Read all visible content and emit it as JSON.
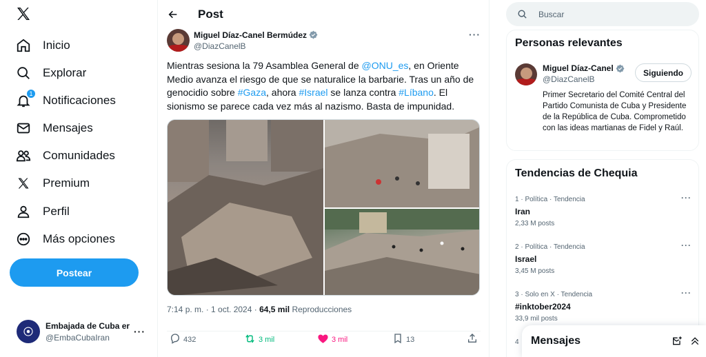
{
  "nav": {
    "items": [
      {
        "label": "Inicio",
        "icon": "home-icon"
      },
      {
        "label": "Explorar",
        "icon": "search-icon"
      },
      {
        "label": "Notificaciones",
        "icon": "bell-icon",
        "badge": "1"
      },
      {
        "label": "Mensajes",
        "icon": "mail-icon"
      },
      {
        "label": "Comunidades",
        "icon": "people-icon"
      },
      {
        "label": "Premium",
        "icon": "x-logo-icon"
      },
      {
        "label": "Perfil",
        "icon": "person-icon"
      },
      {
        "label": "Más opciones",
        "icon": "more-circle-icon"
      }
    ],
    "post_button": "Postear",
    "account": {
      "name": "Embajada de Cuba er",
      "handle": "@EmbaCubaIran"
    }
  },
  "header": {
    "title": "Post"
  },
  "tweet": {
    "author_name": "Miguel Díaz-Canel Bermúdez",
    "author_handle": "@DiazCanelB",
    "text_parts": [
      "Mientras sesiona la 79 Asamblea General de ",
      "@ONU_es",
      ", en Oriente Medio avanza el riesgo de que se naturalice la barbarie. Tras un año de genocidio sobre ",
      "#Gaza",
      ", ahora ",
      "#Israel",
      " se lanza contra ",
      "#Líbano",
      ". El sionismo se parece cada vez más al nazismo. Basta de impunidad."
    ],
    "timestamp": "7:14 p. m. · 1 oct. 2024 · ",
    "views": "64,5 mil",
    "views_label": " Reproducciones",
    "replies": "432",
    "reposts": "3 mil",
    "likes": "3 mil",
    "bookmarks": "13",
    "colors": {
      "repost": "#00ba7c",
      "like": "#f91880",
      "link": "#1d9bf0"
    }
  },
  "search": {
    "placeholder": "Buscar"
  },
  "relevant": {
    "title": "Personas relevantes",
    "name": "Miguel Díaz-Canel",
    "handle": "@DiazCanelB",
    "follow_label": "Siguiendo",
    "bio": "Primer Secretario del Comité Central del Partido Comunista de Cuba y Presidente de la República de Cuba. Comprometido con las ideas martianas de Fidel y Raúl."
  },
  "trends": {
    "title": "Tendencias de Chequia",
    "items": [
      {
        "meta": "1 · Política · Tendencia",
        "name": "Iran",
        "count": "2,33 M posts"
      },
      {
        "meta": "2 · Política · Tendencia",
        "name": "Israel",
        "count": "3,45 M posts"
      },
      {
        "meta": "3 · Solo en X · Tendencia",
        "name": "#inktober2024",
        "count": "33,9 mil posts"
      },
      {
        "meta": "4"
      }
    ]
  },
  "messages_drawer": {
    "title": "Mensajes"
  }
}
